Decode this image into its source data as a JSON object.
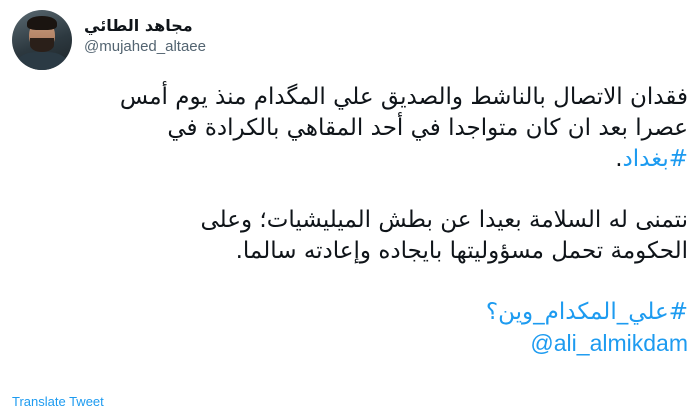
{
  "author": {
    "display_name": "مجاهد الطائي",
    "handle": "@mujahed_altaee"
  },
  "tweet": {
    "p1_line1": "فقدان الاتصال بالناشط والصديق علي المگدام منذ يوم أمس",
    "p1_line2": "عصرا بعد ان كان متواجدا في أحد المقاهي بالكرادة في",
    "p1_hashtag": "#بغداد",
    "p1_end": ".",
    "p2_line1": "نتمنى له السلامة بعيدا عن بطش الميليشيات؛ وعلى",
    "p2_line2": "الحكومة تحمل مسؤوليتها بايجاده وإعادته سالما.",
    "hashtag2": "#علي_المكدام_وين",
    "hashtag2_suffix": "؟",
    "mention": "@ali_almikdam"
  },
  "actions": {
    "translate_label": "Translate Tweet"
  },
  "colors": {
    "link": "#1d9bf0",
    "text": "#0f1419",
    "muted": "#536471"
  }
}
